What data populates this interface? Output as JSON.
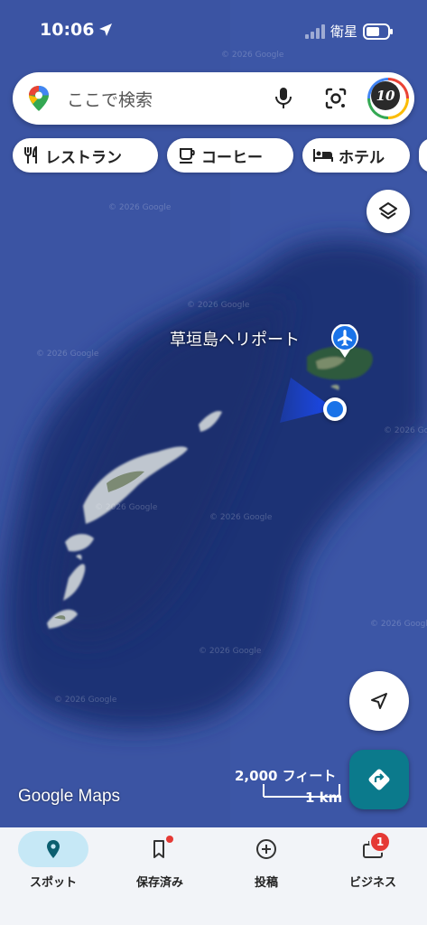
{
  "status_bar": {
    "time": "10:06",
    "carrier": "衛星"
  },
  "search": {
    "placeholder": "ここで検索"
  },
  "chips": [
    {
      "label": "レストラン",
      "icon": "fork-knife-icon"
    },
    {
      "label": "コーヒー",
      "icon": "coffee-cup-icon"
    },
    {
      "label": "ホテル",
      "icon": "bed-icon"
    }
  ],
  "map": {
    "poi_label": "草垣島ヘリポート",
    "poi_icon": "airplane-icon",
    "watermark": "© 2026 Google",
    "scale_imperial": "2,000 フィート",
    "scale_metric": "1 km",
    "logo": "Google Maps"
  },
  "bottom_nav": [
    {
      "label": "スポット",
      "icon": "location-pin-icon",
      "active": true
    },
    {
      "label": "保存済み",
      "icon": "bookmark-icon",
      "dot": true
    },
    {
      "label": "投稿",
      "icon": "add-circle-icon"
    },
    {
      "label": "ビジネス",
      "icon": "briefcase-icon",
      "badge": "1"
    }
  ],
  "colors": {
    "accent_teal": "#0b7a8c",
    "location_blue": "#1a73e8",
    "active_tab": "#c6e8f6",
    "badge_red": "#e53935"
  }
}
